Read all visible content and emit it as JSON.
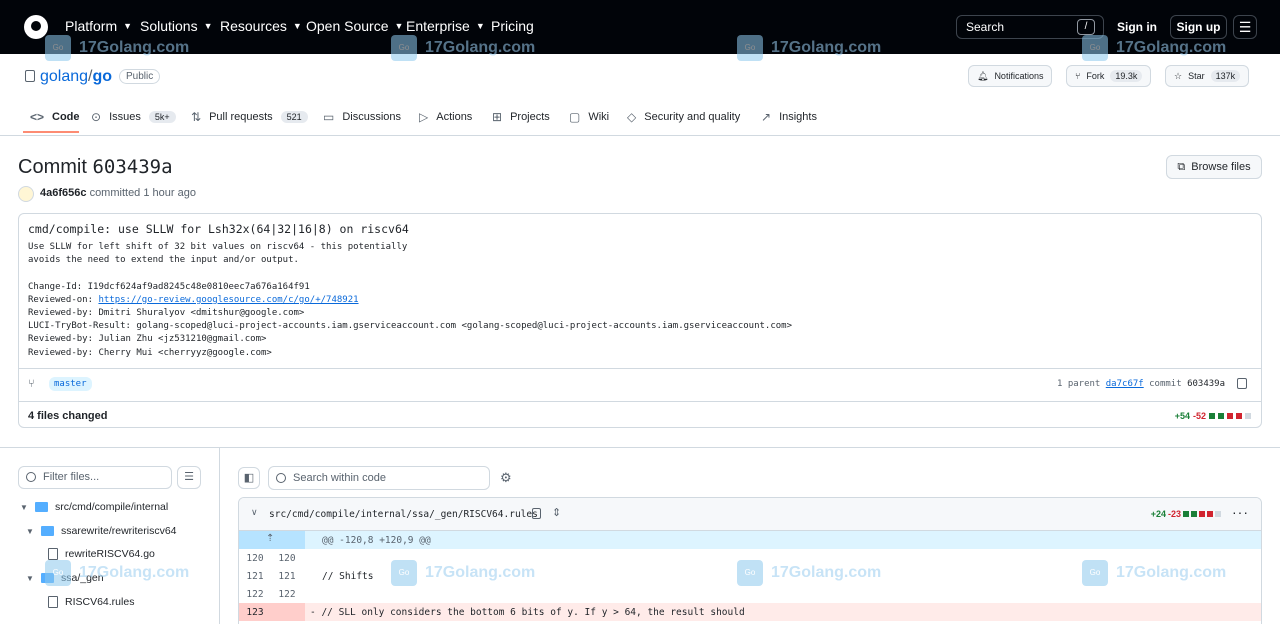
{
  "nav": {
    "items": [
      "Platform",
      "Solutions",
      "Resources",
      "Open Source",
      "Enterprise",
      "Pricing"
    ],
    "search_label": "Search",
    "search_shortcut": "/",
    "sign_in": "Sign in",
    "sign_up": "Sign up"
  },
  "watermark": {
    "text": "17Golang.com",
    "icon_text": "Go"
  },
  "repo": {
    "owner": "golang",
    "separator": "/",
    "name": "go",
    "visibility": "Public",
    "notifications": "Notifications",
    "fork_label": "Fork",
    "fork_count": "19.3k",
    "star_label": "Star",
    "star_count": "137k"
  },
  "tabs": [
    {
      "label": "Code",
      "icon": "code-icon"
    },
    {
      "label": "Issues",
      "count": "5k+",
      "icon": "issue-icon"
    },
    {
      "label": "Pull requests",
      "count": "521",
      "icon": "pull-request-icon"
    },
    {
      "label": "Discussions",
      "icon": "discussion-icon"
    },
    {
      "label": "Actions",
      "icon": "play-icon"
    },
    {
      "label": "Projects",
      "icon": "table-icon"
    },
    {
      "label": "Wiki",
      "icon": "book-icon"
    },
    {
      "label": "Security and quality",
      "icon": "shield-icon"
    },
    {
      "label": "Insights",
      "icon": "graph-icon"
    }
  ],
  "commit": {
    "heading": "Commit",
    "sha_short": "603439a",
    "browse_files": "Browse files",
    "author": "4a6f656c",
    "action": "committed",
    "time": "1 hour ago",
    "title": "cmd/compile: use SLLW for Lsh32x(64|32|16|8) on riscv64",
    "body_lines": [
      "Use SLLW for left shift of 32 bit values on riscv64 - this potentially",
      "avoids the need to extend the input and/or output.",
      "",
      "Change-Id: I19dcf624af9ad8245c48e0810eec7a676a164f91",
      "Reviewed-on: ",
      "Reviewed-by: Dmitri Shuralyov <dmitshur@google.com>",
      "LUCI-TryBot-Result: golang-scoped@luci-project-accounts.iam.gserviceaccount.com <golang-scoped@luci-project-accounts.iam.gserviceaccount.com>",
      "Reviewed-by: Julian Zhu <jz531210@gmail.com>",
      "Reviewed-by: Cherry Mui <cherryyz@google.com>"
    ],
    "review_link": "https://go-review.googlesource.com/c/go/+/748921",
    "branch": "master",
    "parent_label": "1 parent",
    "parent_sha": "da7c67f",
    "commit_label": "commit",
    "commit_sha": "603439a",
    "files_changed": "4 files changed",
    "additions": "+54",
    "deletions": "-52"
  },
  "files": {
    "filter_placeholder": "Filter files...",
    "tree": [
      {
        "label": "src/cmd/compile/internal",
        "type": "folder"
      },
      {
        "label": "ssarewrite/rewriteriscv64",
        "type": "folder"
      },
      {
        "label": "rewriteRISCV64.go",
        "type": "file"
      },
      {
        "label": "ssa/_gen",
        "type": "folder"
      },
      {
        "label": "RISCV64.rules",
        "type": "file"
      }
    ]
  },
  "diff": {
    "search_placeholder": "Search within code",
    "path": "src/cmd/compile/internal/ssa/_gen/RISCV64.rules",
    "additions": "+24",
    "deletions": "-23",
    "hunk_header": "@@ -120,8 +120,9 @@",
    "rows": [
      {
        "old": "120",
        "new": "120",
        "code": ""
      },
      {
        "old": "121",
        "new": "121",
        "code": "// Shifts"
      },
      {
        "old": "122",
        "new": "122",
        "code": ""
      },
      {
        "old": "123",
        "new": "",
        "code": "- // SLL only considers the bottom 6 bits of y. If y > 64, the result should"
      }
    ]
  }
}
